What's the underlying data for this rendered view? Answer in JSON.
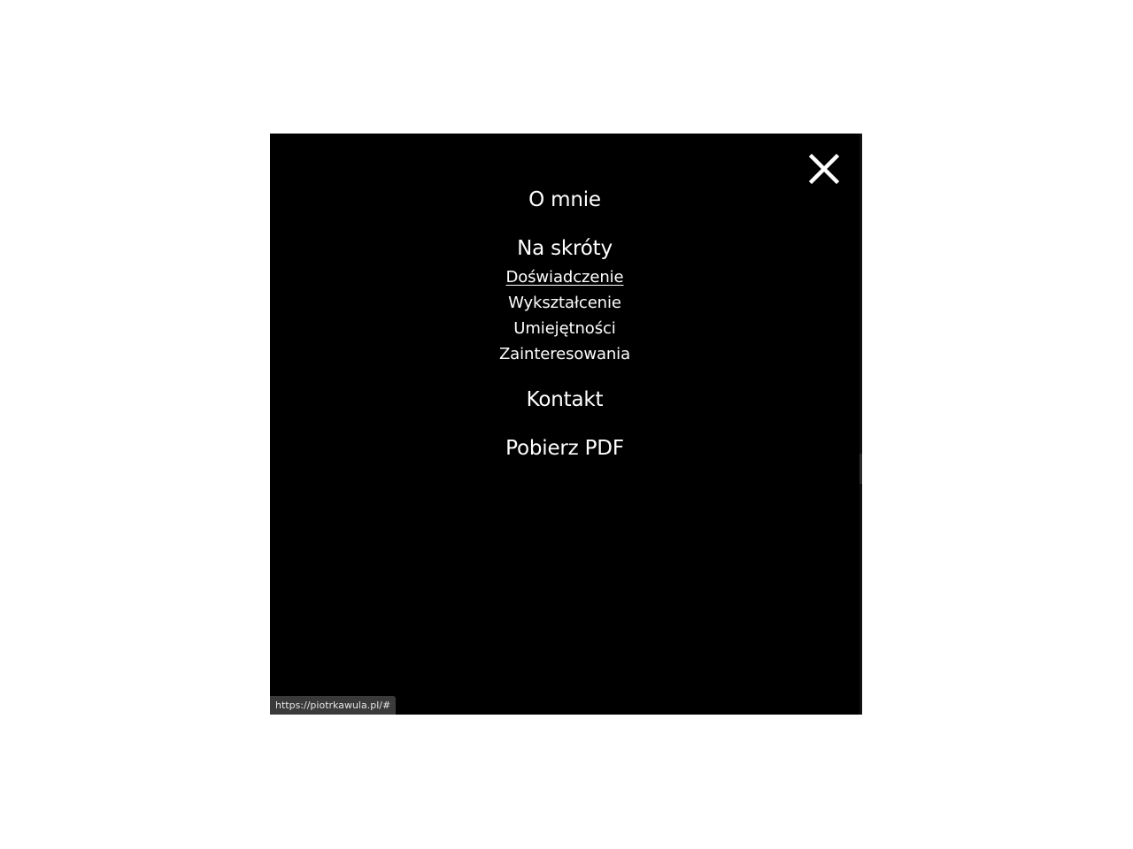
{
  "menu": {
    "close_icon": "close-icon",
    "items": {
      "about": "O mnie",
      "shortcuts": "Na skróty",
      "experience": "Doświadczenie",
      "education": "Wykształcenie",
      "skills": "Umiejętności",
      "interests": "Zainteresowania",
      "contact": "Kontakt",
      "download_pdf": "Pobierz PDF"
    }
  },
  "status_bar": {
    "url": "https://piotrkawula.pl/#"
  },
  "colors": {
    "page_background": "#ffffff",
    "overlay_background": "#000000",
    "text": "#ffffff",
    "status_background": "#3a3a3a"
  }
}
